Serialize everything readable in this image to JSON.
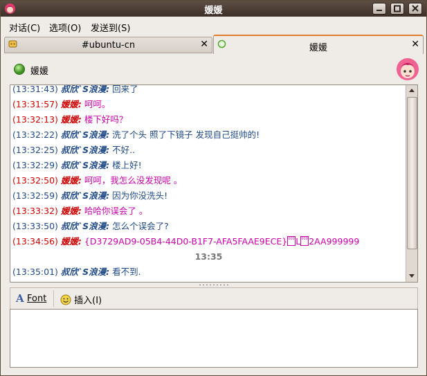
{
  "window": {
    "title": "媛媛"
  },
  "menubar": [
    {
      "label": "对话(C)"
    },
    {
      "label": "选项(O)"
    },
    {
      "label": "发送到(S)"
    }
  ],
  "tabs": [
    {
      "label": "#ubuntu-cn",
      "active": false
    },
    {
      "label": "媛媛",
      "active": true
    }
  ],
  "contact": {
    "name": "媛媛",
    "status_color": "#4ea829"
  },
  "messages": [
    {
      "role": "them",
      "time": "(13:31:43)",
      "nick": "叔欣`S浪漫:",
      "text": "回来了"
    },
    {
      "role": "self",
      "time": "(13:31:57)",
      "nick": "媛媛:",
      "text": "呵呵。"
    },
    {
      "role": "self",
      "time": "(13:32:13)",
      "nick": "媛媛:",
      "text": "楼下好吗？"
    },
    {
      "role": "them",
      "time": "(13:32:22)",
      "nick": "叔欣`S浪漫:",
      "text": "洗了个头 照了下镜子 发现自己挺帅的!"
    },
    {
      "role": "them",
      "time": "(13:32:25)",
      "nick": "叔欣`S浪漫:",
      "text": "不好.."
    },
    {
      "role": "them",
      "time": "(13:32:29)",
      "nick": "叔欣`S浪漫:",
      "text": "楼上好!"
    },
    {
      "role": "self",
      "time": "(13:32:50)",
      "nick": "媛媛:",
      "text": "呵呵，我怎么没发现呢 。"
    },
    {
      "role": "them",
      "time": "(13:32:59)",
      "nick": "叔欣`S浪漫:",
      "text": "因为你没洗头!"
    },
    {
      "role": "self",
      "time": "(13:33:32)",
      "nick": "媛媛:",
      "text": "哈哈你误会了 。"
    },
    {
      "role": "them",
      "time": "(13:33:50)",
      "nick": "叔欣`S浪漫:",
      "text": "怎么个误会了?"
    },
    {
      "role": "self",
      "time": "(13:34:56)",
      "nick": "媛媛:",
      "text": "{D3729AD9-05B4-44D0-B1F7-AFA5FAAE9ECE}",
      "glyph1": "0001",
      "mid": "L",
      "glyph2": "0001",
      "tail": "2AA999999"
    },
    {
      "role": "center",
      "text": "13:35"
    },
    {
      "role": "them",
      "time": "(13:35:01)",
      "nick": "叔欣`S浪漫:",
      "text": "看不到."
    }
  ],
  "toolbar": {
    "font_label": "Font",
    "insert_label": "插入(I)"
  },
  "colors": {
    "accent_tab": "#e07c2a",
    "them_text": "#204a87",
    "self_name": "#cc0000",
    "self_text": "#cc00aa"
  },
  "icons": {
    "title": "app-avatar-icon",
    "tab1": "irc-channel-icon",
    "tab2": "status-available-icon",
    "font": "font-icon",
    "insert": "smiley-icon"
  }
}
